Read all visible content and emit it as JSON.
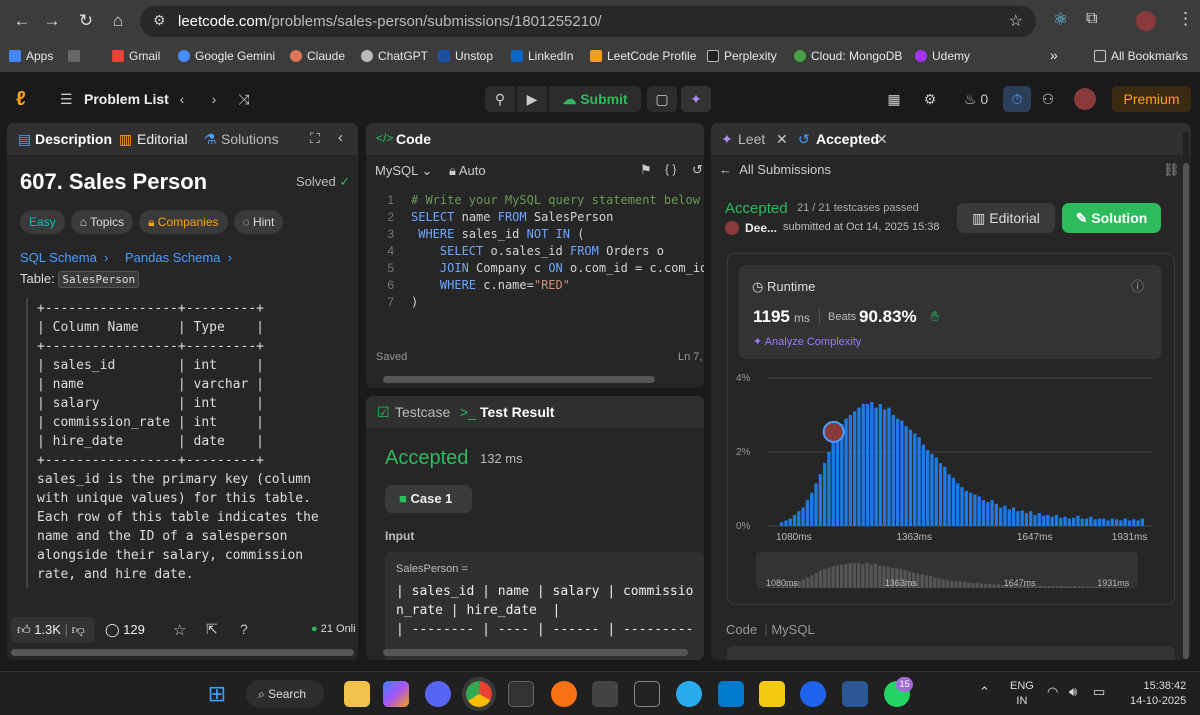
{
  "browser": {
    "url_host": "leetcode.com",
    "url_path": "/problems/sales-person/submissions/1801255210/",
    "bookmarks": [
      "Apps",
      "Gmail",
      "Google Gemini",
      "Claude",
      "ChatGPT",
      "Unstop",
      "LinkedIn",
      "LeetCode Profile",
      "Perplexity",
      "Cloud: MongoDB",
      "Udemy"
    ],
    "all_bookmarks": "All Bookmarks",
    "more": "»"
  },
  "header": {
    "problem_list": "Problem List",
    "submit": "Submit",
    "streak": "0",
    "premium": "Premium"
  },
  "left": {
    "tabs": [
      "Description",
      "Editorial",
      "Solutions"
    ],
    "title": "607. Sales Person",
    "status": "Solved",
    "tags": [
      "Easy",
      "Topics",
      "Companies",
      "Hint"
    ],
    "links": [
      "SQL Schema",
      "Pandas Schema"
    ],
    "table_label": "Table:",
    "table_name": "SalesPerson",
    "schema_lines": [
      "+-----------------+---------+",
      "| Column Name     | Type    |",
      "+-----------------+---------+",
      "| sales_id        | int     |",
      "| name            | varchar |",
      "| salary          | int     |",
      "| commission_rate | int     |",
      "| hire_date       | date    |",
      "+-----------------+---------+"
    ],
    "description_lines": [
      "sales_id is the primary key (column",
      "with unique values) for this table.",
      "Each row of this table indicates the",
      "name and the ID of a salesperson",
      "alongside their salary, commission",
      "rate, and hire date."
    ],
    "likes": "1.3K",
    "comments": "129",
    "online": "21 Onli"
  },
  "code": {
    "tab": "Code",
    "language": "MySQL",
    "auto": "Auto",
    "lines": [
      "# Write your MySQL query statement below",
      "SELECT name FROM SalesPerson",
      " WHERE sales_id NOT IN (",
      "    SELECT o.sales_id FROM Orders o",
      "    JOIN Company c ON o.com_id = c.com_id",
      "    WHERE c.name=\"RED\"",
      ")"
    ],
    "saved": "Saved",
    "cursor": "Ln 7,"
  },
  "test": {
    "tabs": [
      "Testcase",
      "Test Result"
    ],
    "status": "Accepted",
    "runtime": "132 ms",
    "case": "Case 1",
    "input_label": "Input",
    "table_name": "SalesPerson =",
    "input_lines": [
      "| sales_id | name | salary | commissio",
      "n_rate | hire_date  |",
      "| -------- | ---- | ------ | ---------"
    ]
  },
  "submission": {
    "tabs": [
      "Leet",
      "Accepted"
    ],
    "back": "All Submissions",
    "status": "Accepted",
    "passed": "21 / 21 testcases passed",
    "user": "Dee...",
    "submitted": "submitted at Oct 14, 2025 15:38",
    "editorial": "Editorial",
    "solution": "Solution",
    "runtime_label": "Runtime",
    "runtime_value": "1195",
    "runtime_unit": "ms",
    "beats_label": "Beats",
    "beats_value": "90.83%",
    "analyze": "Analyze Complexity",
    "code_label": "Code",
    "code_lang": "MySQL"
  },
  "chart_data": {
    "type": "bar",
    "y_ticks": [
      "4%",
      "2%",
      "0%"
    ],
    "ylim": [
      0,
      4
    ],
    "x_ticks": [
      "1080ms",
      "1363ms",
      "1647ms",
      "1931ms"
    ],
    "user_bin_index": 12,
    "values": [
      0.1,
      0.15,
      0.2,
      0.3,
      0.4,
      0.5,
      0.7,
      0.9,
      1.15,
      1.4,
      1.7,
      2.0,
      2.3,
      2.55,
      2.75,
      2.9,
      3.0,
      3.1,
      3.2,
      3.3,
      3.3,
      3.35,
      3.2,
      3.3,
      3.15,
      3.2,
      3.0,
      2.9,
      2.85,
      2.7,
      2.6,
      2.5,
      2.4,
      2.2,
      2.05,
      1.95,
      1.85,
      1.7,
      1.6,
      1.4,
      1.3,
      1.15,
      1.05,
      0.95,
      0.9,
      0.85,
      0.8,
      0.7,
      0.65,
      0.7,
      0.6,
      0.5,
      0.55,
      0.45,
      0.5,
      0.4,
      0.42,
      0.35,
      0.4,
      0.3,
      0.35,
      0.28,
      0.3,
      0.25,
      0.3,
      0.22,
      0.25,
      0.2,
      0.22,
      0.28,
      0.2,
      0.2,
      0.25,
      0.18,
      0.2,
      0.2,
      0.15,
      0.2,
      0.18,
      0.15,
      0.2,
      0.15,
      0.18,
      0.15,
      0.2
    ],
    "colors": {
      "bar": "#1e7be6",
      "bg": "#333333"
    }
  },
  "taskbar": {
    "search": "Search",
    "badge": "15",
    "lang1": "ENG",
    "lang2": "IN",
    "time": "15:38:42",
    "date": "14-10-2025"
  }
}
